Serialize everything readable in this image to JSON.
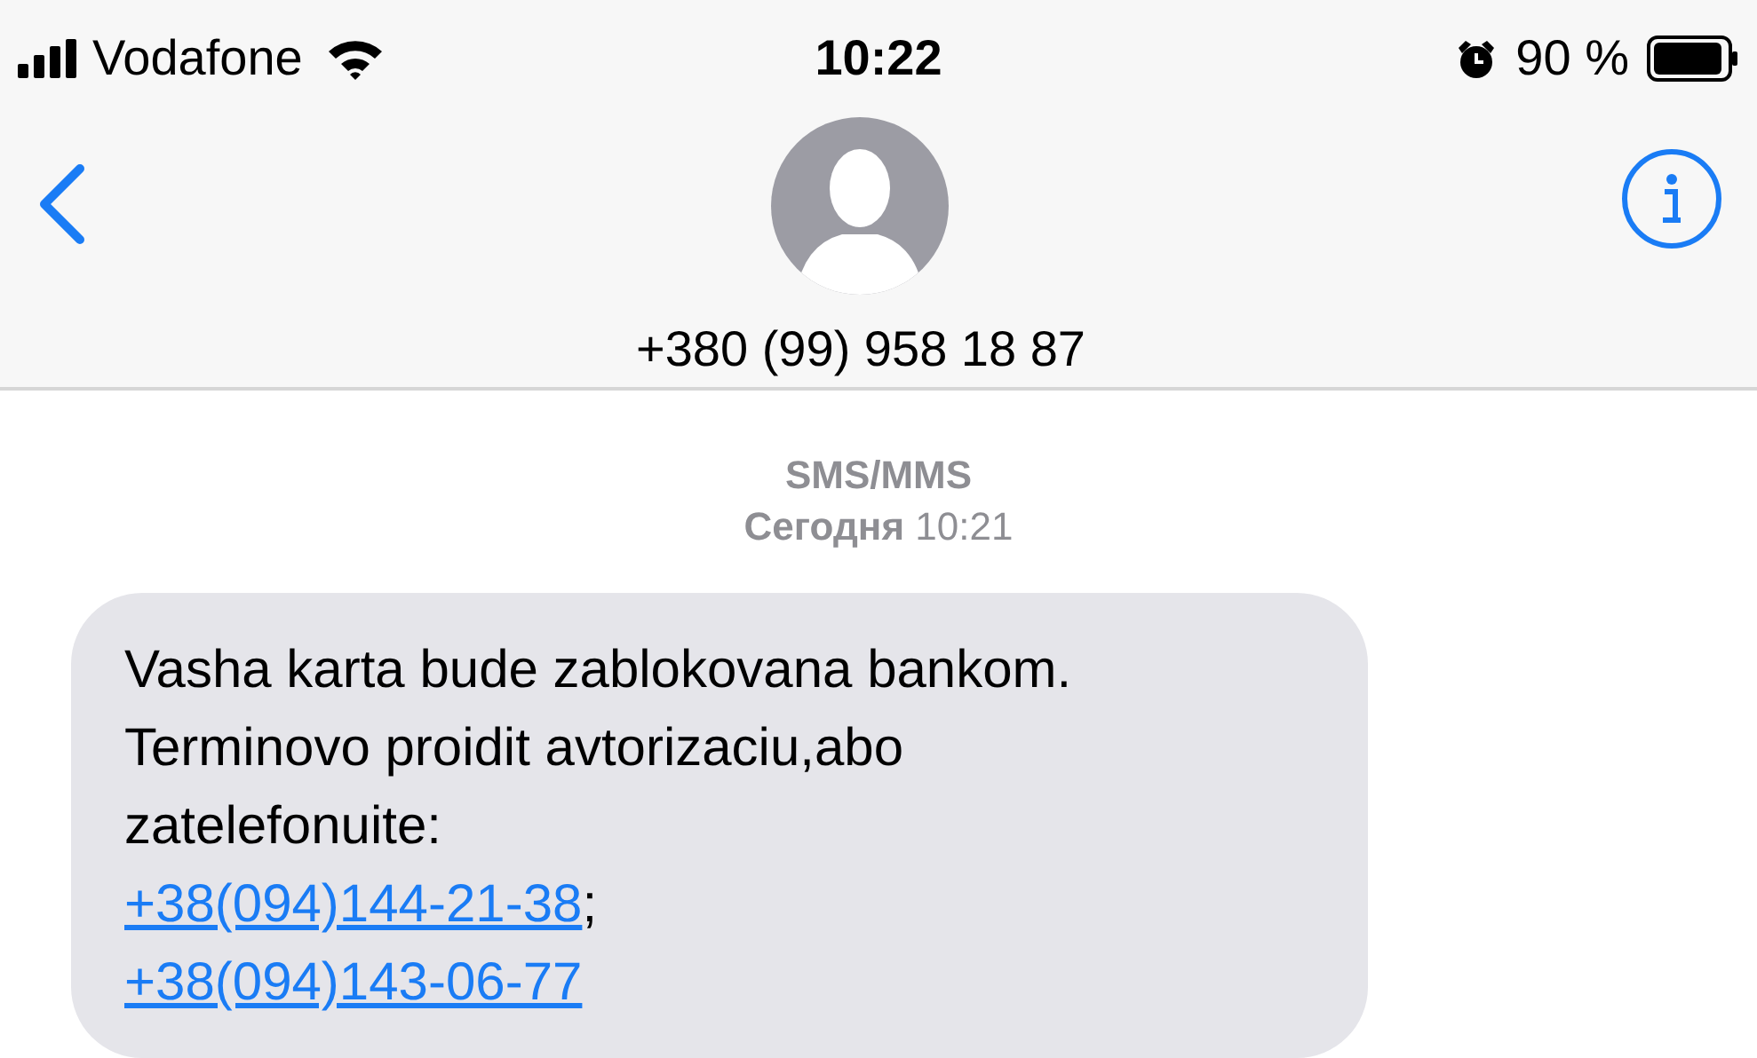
{
  "status_bar": {
    "carrier": "Vodafone",
    "time": "10:22",
    "battery": "90 %"
  },
  "header": {
    "contact": "+380 (99) 958 18 87"
  },
  "conversation": {
    "service": "SMS/MMS",
    "timestamp": "**Сегодня** 10:21"
  },
  "message": {
    "lines": [
      [
        {
          "kind": "text",
          "text": "Vasha karta bude zablokovana bankom."
        }
      ],
      [
        {
          "kind": "text",
          "text": "Terminovo proidit avtorizaciu,abo"
        }
      ],
      [
        {
          "kind": "text",
          "text": "zatelefonuite:"
        }
      ],
      [
        {
          "kind": "link",
          "text": "+38(094)144-21-38"
        },
        {
          "kind": "text",
          "text": ";"
        }
      ],
      [
        {
          "kind": "link",
          "text": "+38(094)143-06-77"
        }
      ]
    ]
  }
}
